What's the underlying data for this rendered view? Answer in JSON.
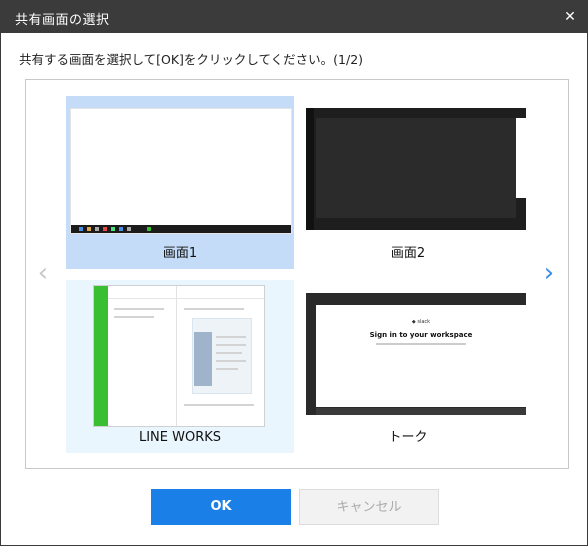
{
  "dialog": {
    "title": "共有画面の選択",
    "close_glyph": "✕",
    "instruction": "共有する画面を選択して[OK]をクリックしてください。(1/2)"
  },
  "nav": {
    "prev_glyph": "‹",
    "next_glyph": "›"
  },
  "screens": [
    {
      "label": "画面1",
      "state": "selected"
    },
    {
      "label": "画面2",
      "state": "normal"
    },
    {
      "label": "LINE WORKS",
      "state": "hover"
    },
    {
      "label": "トーク",
      "state": "normal"
    }
  ],
  "slack_preview": {
    "brand": "◆ slack",
    "heading": "Sign in to your workspace"
  },
  "buttons": {
    "ok": "OK",
    "cancel": "キャンセル"
  },
  "colors": {
    "selected": "#c4dcf7",
    "hover": "#eaf6fd",
    "primary": "#1b7fe8",
    "titlebar": "#3b3b3b"
  }
}
